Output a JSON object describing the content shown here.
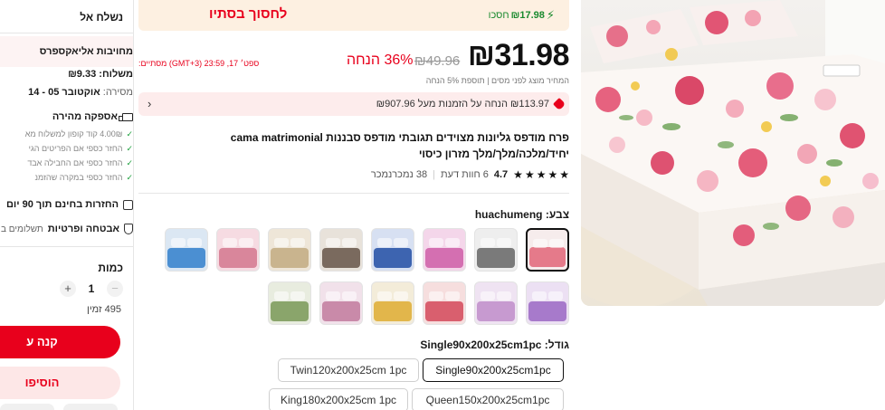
{
  "sidebar": {
    "ship_to": "נשלח אל",
    "commitment_title": "מחויבות אליאקספרס",
    "shipping_label": "משלוח:",
    "shipping_value": "₪9.33",
    "delivery_label": "מסירה:",
    "delivery_value": "אוקטובר 05 - 14",
    "fast_delivery": "אספקה מהירה",
    "benefits": [
      "4.00₪ קוד קופון למשלוח מא",
      "החזר כספי אם הפריטים הגי",
      "החזר כספי אם החבילה אבד",
      "החזר כספי במקרה שהזמנ"
    ],
    "free_returns": "החזרות בחינם תוך 90 יום",
    "security_label": "אבטחה ופרטיות",
    "security_sub": "תשלומים ב",
    "quantity_label": "כמות",
    "quantity_value": "1",
    "minus": "−",
    "plus": "+",
    "stock": "495 זמין",
    "buy_now": "קנה ע",
    "add_to_cart": "הוסיפו"
  },
  "savings": {
    "cta": "לחסוך בסתיו",
    "amount": "₪17.98",
    "amount_label": "חסכו",
    "bolt": "⚡"
  },
  "price": {
    "current": "₪31.98",
    "original": "₪49.96",
    "discount": "36% הנחה",
    "timer_label": "מסתיים:",
    "timer_value": "ספט׳ 17, 23:59 (GMT+3)",
    "note": "המחיר מוצג לפני מסים  |  תוספת 5% הנחה"
  },
  "coupon": {
    "text": "₪113.97 הנחה על הזמנות מעל ₪907.96",
    "arrow": "‹"
  },
  "product": {
    "title": "פרח מודפס גליונות מצוידים תגובתי מודפס סבננות cama matrimonial יחיד/מלכה/מלך/מלך מזרון כיסוי",
    "rating": "4.7",
    "stars": [
      "★",
      "★",
      "★",
      "★",
      "★"
    ],
    "reviews": "6 חוות דעת",
    "separator": "|",
    "sold": "38 נמכרנמכר"
  },
  "color": {
    "label": "צבע: huachumeng",
    "swatches": [
      {
        "name": "huachumeng",
        "bg": "#f6ecec",
        "base": "#e57a8a"
      },
      {
        "name": "gray-check",
        "bg": "#eeeeee",
        "base": "#7a7a7a"
      },
      {
        "name": "pink-heart",
        "bg": "#f4d6ea",
        "base": "#d46fb1"
      },
      {
        "name": "blue-pattern",
        "bg": "#d7e0f2",
        "base": "#3d64b0"
      },
      {
        "name": "brown-pattern",
        "bg": "#e8e2da",
        "base": "#7a6a5e"
      },
      {
        "name": "beige-floral",
        "bg": "#eee6d8",
        "base": "#c9b48e"
      },
      {
        "name": "pink-floral",
        "bg": "#f6dbe2",
        "base": "#d9869b"
      },
      {
        "name": "blue-cartoon",
        "bg": "#dbe7f3",
        "base": "#4b8fd2"
      },
      {
        "name": "purple",
        "bg": "#ece0f3",
        "base": "#a77acb"
      },
      {
        "name": "lavender-floral",
        "bg": "#efe3f2",
        "base": "#c79ad0"
      },
      {
        "name": "red-floral",
        "bg": "#f6dede",
        "base": "#d95f6e"
      },
      {
        "name": "yellow-floral",
        "bg": "#f3ecd9",
        "base": "#e2b64b"
      },
      {
        "name": "pink-blue-floral",
        "bg": "#f1e1ea",
        "base": "#c98aa9"
      },
      {
        "name": "green-floral",
        "bg": "#e8ecdf",
        "base": "#8aa56b"
      }
    ]
  },
  "size": {
    "label": "גודל: Single90x200x25cm1pc",
    "options": [
      {
        "label": "Single90x200x25cm1pc",
        "selected": true
      },
      {
        "label": "Twin120x200x25cm 1pc",
        "selected": false
      },
      {
        "label": "Queen150x200x25cm1pc",
        "selected": false
      },
      {
        "label": "King180x200x25cm 1pc",
        "selected": false
      }
    ]
  },
  "colors": {
    "brand_red": "#e8001c",
    "savings_green": "#1a8a2e",
    "savings_bg": "#fdf0e1",
    "coupon_bg": "#fdecec"
  }
}
